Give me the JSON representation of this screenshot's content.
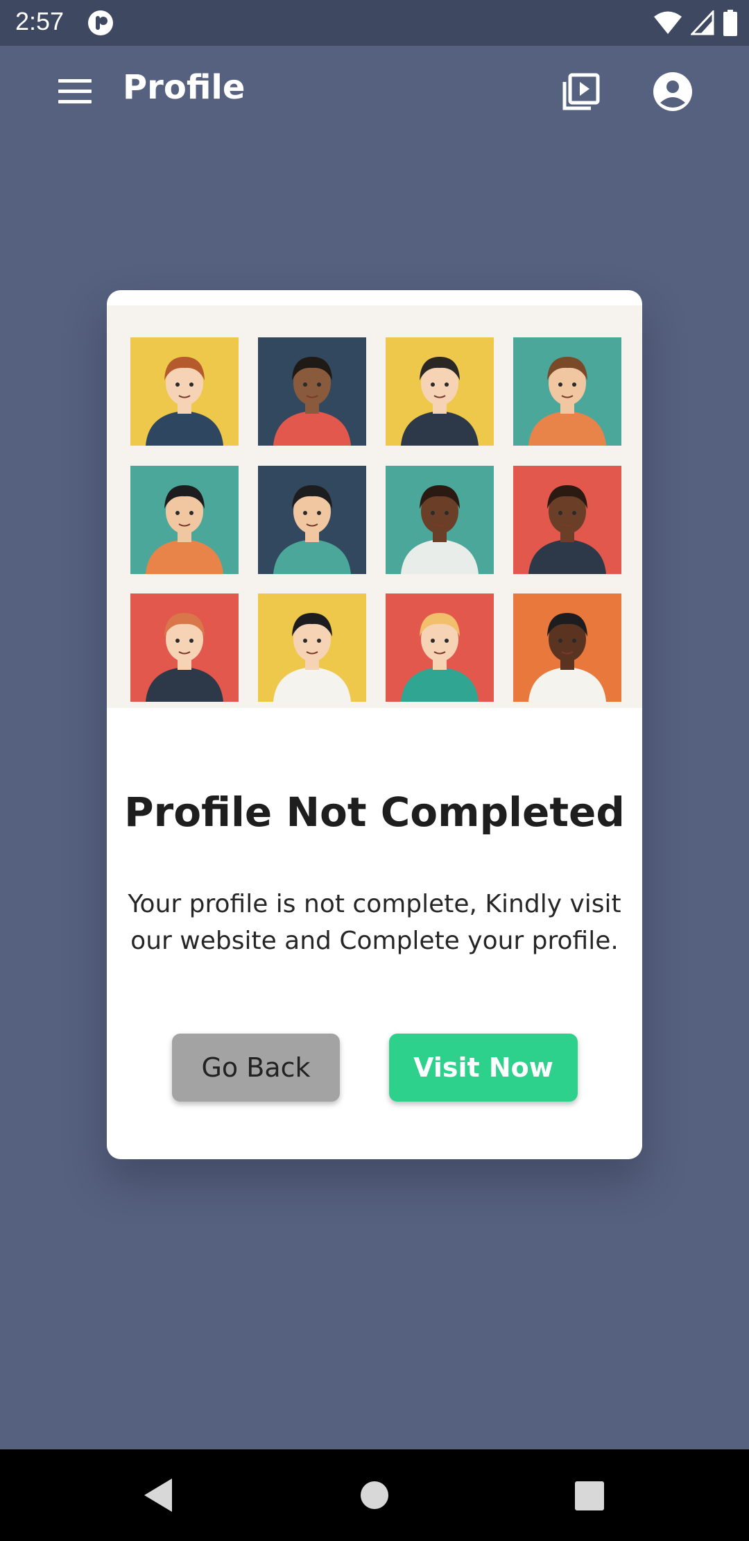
{
  "status_bar": {
    "time": "2:57",
    "icons": [
      "app-notification-icon",
      "wifi-icon",
      "signal-icon",
      "battery-icon"
    ]
  },
  "app_bar": {
    "title": "Profile",
    "icons": [
      "menu-icon",
      "video-library-icon",
      "account-circle-icon"
    ]
  },
  "dialog": {
    "title": "Profile Not Completed",
    "message": "Your profile is not complete, Kindly visit our website and Complete your profile.",
    "buttons": {
      "back": "Go Back",
      "visit": "Visit Now"
    }
  },
  "illustration": {
    "tiles": [
      {
        "bg": "#eec84a",
        "skin": "#f6d3b5",
        "hair": "#b55a2c",
        "shirt": "#2f4660"
      },
      {
        "bg": "#32485e",
        "skin": "#8a5a3c",
        "hair": "#1f1a16",
        "shirt": "#e2584c"
      },
      {
        "bg": "#eec84a",
        "skin": "#f6d3b5",
        "hair": "#2a2725",
        "shirt": "#2d3948"
      },
      {
        "bg": "#4aa79a",
        "skin": "#f1c7a2",
        "hair": "#7a4a28",
        "shirt": "#e8834a"
      },
      {
        "bg": "#4aa79a",
        "skin": "#f1c7a2",
        "hair": "#1d1d1f",
        "shirt": "#e8834a"
      },
      {
        "bg": "#32485e",
        "skin": "#f1c7a2",
        "hair": "#1d1d1f",
        "shirt": "#4aa79a"
      },
      {
        "bg": "#4aa79a",
        "skin": "#6b3f27",
        "hair": "#2a1a12",
        "shirt": "#e9ede9"
      },
      {
        "bg": "#e2584c",
        "skin": "#6b3f27",
        "hair": "#2a1a12",
        "shirt": "#2d3948"
      },
      {
        "bg": "#e2584c",
        "skin": "#f6d3b5",
        "hair": "#d9774a",
        "shirt": "#2d3948"
      },
      {
        "bg": "#eec84a",
        "skin": "#f6d3b5",
        "hair": "#1d1d1f",
        "shirt": "#f5f3ee"
      },
      {
        "bg": "#e2584c",
        "skin": "#f6d3b5",
        "hair": "#f2c06c",
        "shirt": "#2fa592"
      },
      {
        "bg": "#e8783c",
        "skin": "#5a3421",
        "hair": "#1d1d1f",
        "shirt": "#f5f3ee"
      }
    ]
  },
  "colors": {
    "background": "#56617f",
    "status_bar": "#3e4860",
    "accent": "#2ed18b",
    "secondary_button": "#a3a3a3"
  },
  "nav_bar": {
    "icons": [
      "back-icon",
      "home-icon",
      "recents-icon"
    ]
  }
}
